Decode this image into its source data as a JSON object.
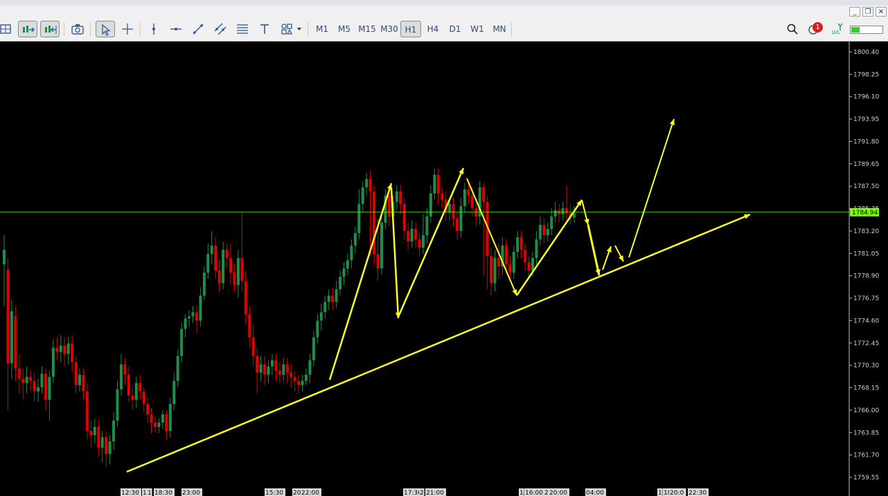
{
  "window_controls": {
    "minimize": "_",
    "restore": "❐",
    "close": "✕"
  },
  "toolbar": {
    "timeframes": [
      "M1",
      "M5",
      "M15",
      "M30",
      "H1",
      "H4",
      "D1",
      "W1",
      "MN"
    ],
    "active_timeframe": "H1",
    "notification_count": "1",
    "signal_label": "LVL"
  },
  "chart": {
    "background": "#000000",
    "bull_color": "#1e8f4a",
    "bear_color": "#e10000",
    "annotation_color": "#ffff20",
    "bid_line_color": "#7cfc00",
    "price_axis": {
      "ticks": [
        "1800.40",
        "1798.25",
        "1796.10",
        "1793.95",
        "1791.80",
        "1789.65",
        "1787.50",
        "1785.35",
        "1783.20",
        "1781.05",
        "1778.90",
        "1776.75",
        "1774.60",
        "1772.45",
        "1770.30",
        "1768.15",
        "1766.00",
        "1763.85",
        "1761.70",
        "1759.55"
      ]
    },
    "current_price": "1784.94",
    "time_labels": [
      "12:30",
      "1",
      "1",
      "18:30",
      "23:00",
      "15:30",
      "20:",
      "22:00",
      "17:30",
      "2",
      "21:00",
      "1",
      "16:00",
      "2",
      "20:00",
      "04:00",
      "1",
      "18:",
      "20:0",
      "22:30"
    ]
  },
  "chart_data": {
    "type": "candlestick",
    "y_axis": {
      "min": 1759.55,
      "max": 1800.4,
      "tick_labels": [
        "1800.40",
        "1798.25",
        "1796.10",
        "1793.95",
        "1791.80",
        "1789.65",
        "1787.50",
        "1785.35",
        "1783.20",
        "1781.05",
        "1778.90",
        "1776.75",
        "1774.60",
        "1772.45",
        "1770.30",
        "1768.15",
        "1766.00",
        "1763.85",
        "1761.70",
        "1759.55"
      ]
    },
    "current_price": 1784.94,
    "x_tick_labels": [
      "12:30",
      "1",
      "1",
      "18:30",
      "23:00",
      "15:30",
      "20:",
      "22:00",
      "17:30",
      "2",
      "21:00",
      "1",
      "16:00",
      "2",
      "20:00",
      "04:00",
      "1",
      "18:",
      "20:0",
      "22:30"
    ],
    "candles": [
      [
        1780.0,
        1781.4,
        1776.0,
        1782.8
      ],
      [
        1779.5,
        1770.5,
        1766.0,
        1780.6
      ],
      [
        1770.5,
        1775.5,
        1769.0,
        1776.6
      ],
      [
        1775.0,
        1770.0,
        1768.8,
        1776.0
      ],
      [
        1770.0,
        1769.0,
        1767.6,
        1771.4
      ],
      [
        1769.0,
        1768.6,
        1767.0,
        1770.0
      ],
      [
        1768.6,
        1769.2,
        1767.6,
        1770.2
      ],
      [
        1769.2,
        1768.8,
        1767.8,
        1769.8
      ],
      [
        1768.8,
        1767.8,
        1766.8,
        1769.6
      ],
      [
        1767.8,
        1768.2,
        1766.8,
        1769.0
      ],
      [
        1768.2,
        1769.5,
        1767.6,
        1770.2
      ],
      [
        1769.5,
        1767.0,
        1766.0,
        1770.0
      ],
      [
        1767.0,
        1769.2,
        1765.0,
        1769.8
      ],
      [
        1769.2,
        1772.0,
        1768.6,
        1772.8
      ],
      [
        1772.0,
        1771.6,
        1770.8,
        1773.0
      ],
      [
        1771.6,
        1772.2,
        1770.6,
        1773.2
      ],
      [
        1772.2,
        1771.4,
        1770.2,
        1773.0
      ],
      [
        1771.4,
        1772.4,
        1770.4,
        1773.0
      ],
      [
        1772.4,
        1770.6,
        1769.6,
        1773.2
      ],
      [
        1770.6,
        1768.4,
        1767.6,
        1771.2
      ],
      [
        1768.4,
        1769.4,
        1767.8,
        1770.0
      ],
      [
        1769.4,
        1767.8,
        1767.0,
        1770.0
      ],
      [
        1767.8,
        1764.0,
        1763.2,
        1768.6
      ],
      [
        1764.0,
        1763.6,
        1762.4,
        1765.0
      ],
      [
        1763.6,
        1764.4,
        1762.8,
        1765.2
      ],
      [
        1764.4,
        1762.4,
        1761.6,
        1765.0
      ],
      [
        1762.4,
        1763.4,
        1761.0,
        1764.0
      ],
      [
        1763.4,
        1761.8,
        1760.6,
        1764.0
      ],
      [
        1761.8,
        1763.0,
        1760.8,
        1763.6
      ],
      [
        1763.0,
        1765.0,
        1762.2,
        1765.8
      ],
      [
        1765.0,
        1768.0,
        1764.4,
        1768.8
      ],
      [
        1768.0,
        1770.4,
        1767.4,
        1771.4
      ],
      [
        1770.4,
        1769.4,
        1768.4,
        1771.0
      ],
      [
        1769.4,
        1767.4,
        1766.8,
        1770.2
      ],
      [
        1767.4,
        1767.0,
        1766.0,
        1768.2
      ],
      [
        1767.0,
        1768.6,
        1766.2,
        1769.2
      ],
      [
        1768.6,
        1767.8,
        1767.0,
        1769.4
      ],
      [
        1767.8,
        1766.6,
        1765.8,
        1768.2
      ],
      [
        1766.6,
        1765.6,
        1764.8,
        1767.2
      ],
      [
        1765.6,
        1764.8,
        1763.8,
        1766.2
      ],
      [
        1764.8,
        1764.4,
        1763.8,
        1765.4
      ],
      [
        1764.4,
        1764.8,
        1763.8,
        1765.2
      ],
      [
        1764.8,
        1765.6,
        1764.2,
        1766.0
      ],
      [
        1765.6,
        1764.0,
        1763.2,
        1766.0
      ],
      [
        1764.0,
        1766.6,
        1763.4,
        1767.2
      ],
      [
        1766.6,
        1768.8,
        1766.0,
        1769.6
      ],
      [
        1768.8,
        1771.2,
        1768.2,
        1771.8
      ],
      [
        1771.2,
        1773.8,
        1770.6,
        1774.4
      ],
      [
        1773.8,
        1774.8,
        1773.0,
        1775.2
      ],
      [
        1774.8,
        1775.0,
        1774.0,
        1775.6
      ],
      [
        1775.0,
        1775.4,
        1774.4,
        1776.0
      ],
      [
        1775.4,
        1774.6,
        1773.4,
        1776.0
      ],
      [
        1774.6,
        1777.0,
        1774.0,
        1777.8
      ],
      [
        1777.0,
        1779.2,
        1776.6,
        1779.8
      ],
      [
        1779.2,
        1781.0,
        1778.6,
        1782.0
      ],
      [
        1781.0,
        1781.8,
        1780.0,
        1783.2
      ],
      [
        1781.8,
        1779.4,
        1778.6,
        1782.6
      ],
      [
        1779.4,
        1778.2,
        1777.4,
        1780.4
      ],
      [
        1778.2,
        1781.4,
        1777.6,
        1782.2
      ],
      [
        1781.4,
        1780.6,
        1779.6,
        1782.0
      ],
      [
        1780.6,
        1779.2,
        1778.0,
        1782.0
      ],
      [
        1779.2,
        1778.0,
        1777.4,
        1780.0
      ],
      [
        1778.0,
        1780.6,
        1776.8,
        1781.4
      ],
      [
        1780.6,
        1778.4,
        1777.4,
        1785.0
      ],
      [
        1778.4,
        1775.2,
        1774.2,
        1779.4
      ],
      [
        1775.2,
        1773.0,
        1772.0,
        1776.0
      ],
      [
        1773.0,
        1771.2,
        1770.2,
        1774.2
      ],
      [
        1771.2,
        1769.6,
        1767.6,
        1772.0
      ],
      [
        1769.6,
        1770.4,
        1768.8,
        1771.2
      ],
      [
        1770.4,
        1769.4,
        1768.4,
        1771.2
      ],
      [
        1769.4,
        1770.2,
        1768.6,
        1770.8
      ],
      [
        1770.2,
        1770.8,
        1769.4,
        1771.4
      ],
      [
        1770.8,
        1769.8,
        1768.8,
        1771.4
      ],
      [
        1769.8,
        1769.4,
        1768.6,
        1770.6
      ],
      [
        1769.4,
        1770.4,
        1768.8,
        1771.0
      ],
      [
        1770.4,
        1769.6,
        1768.6,
        1771.0
      ],
      [
        1769.6,
        1769.2,
        1768.2,
        1770.4
      ],
      [
        1769.2,
        1768.8,
        1767.8,
        1769.8
      ],
      [
        1768.8,
        1768.4,
        1767.6,
        1769.4
      ],
      [
        1768.4,
        1768.8,
        1767.8,
        1769.4
      ],
      [
        1768.8,
        1769.4,
        1768.4,
        1770.0
      ],
      [
        1769.4,
        1770.8,
        1768.6,
        1771.4
      ],
      [
        1770.8,
        1773.0,
        1770.2,
        1773.6
      ],
      [
        1773.0,
        1774.6,
        1772.4,
        1775.2
      ],
      [
        1774.6,
        1775.4,
        1773.6,
        1776.2
      ],
      [
        1775.4,
        1776.4,
        1774.8,
        1777.0
      ],
      [
        1776.4,
        1777.0,
        1775.6,
        1777.6
      ],
      [
        1777.0,
        1776.4,
        1775.6,
        1777.8
      ],
      [
        1776.4,
        1777.6,
        1775.8,
        1778.4
      ],
      [
        1777.6,
        1778.8,
        1777.0,
        1779.4
      ],
      [
        1778.8,
        1779.6,
        1778.0,
        1780.2
      ],
      [
        1779.6,
        1780.4,
        1779.0,
        1781.0
      ],
      [
        1780.4,
        1781.8,
        1779.6,
        1782.4
      ],
      [
        1781.8,
        1783.0,
        1781.0,
        1783.6
      ],
      [
        1783.0,
        1785.8,
        1782.4,
        1787.2
      ],
      [
        1785.8,
        1787.4,
        1785.0,
        1788.0
      ],
      [
        1787.4,
        1788.2,
        1786.6,
        1788.8
      ],
      [
        1788.2,
        1787.0,
        1780.8,
        1789.0
      ],
      [
        1787.0,
        1781.0,
        1780.0,
        1787.6
      ],
      [
        1781.0,
        1779.6,
        1778.4,
        1784.4
      ],
      [
        1779.6,
        1784.0,
        1779.0,
        1784.8
      ],
      [
        1784.0,
        1786.6,
        1783.4,
        1787.2
      ],
      [
        1786.6,
        1784.6,
        1783.6,
        1787.4
      ],
      [
        1784.6,
        1786.0,
        1783.8,
        1786.6
      ],
      [
        1786.0,
        1787.0,
        1785.2,
        1787.6
      ],
      [
        1787.0,
        1785.8,
        1784.8,
        1787.6
      ],
      [
        1785.8,
        1783.2,
        1782.4,
        1786.4
      ],
      [
        1783.2,
        1782.2,
        1781.4,
        1784.0
      ],
      [
        1782.2,
        1783.4,
        1781.6,
        1784.2
      ],
      [
        1783.4,
        1782.4,
        1781.6,
        1784.0
      ],
      [
        1782.4,
        1781.6,
        1780.8,
        1783.0
      ],
      [
        1781.6,
        1782.8,
        1781.0,
        1784.8
      ],
      [
        1782.8,
        1784.6,
        1782.0,
        1785.4
      ],
      [
        1784.6,
        1786.8,
        1784.0,
        1787.6
      ],
      [
        1786.8,
        1788.6,
        1786.2,
        1789.2
      ],
      [
        1788.6,
        1786.8,
        1785.8,
        1789.2
      ],
      [
        1786.8,
        1786.2,
        1785.4,
        1787.4
      ],
      [
        1786.2,
        1785.0,
        1784.2,
        1787.0
      ],
      [
        1785.0,
        1785.8,
        1784.2,
        1786.4
      ],
      [
        1785.8,
        1784.4,
        1783.6,
        1786.4
      ],
      [
        1784.4,
        1783.2,
        1782.4,
        1785.0
      ],
      [
        1783.2,
        1785.6,
        1782.6,
        1786.4
      ],
      [
        1785.6,
        1787.2,
        1785.0,
        1787.8
      ],
      [
        1787.2,
        1786.6,
        1785.8,
        1787.8
      ],
      [
        1786.6,
        1785.4,
        1784.6,
        1787.4
      ],
      [
        1785.4,
        1784.6,
        1783.6,
        1786.0
      ],
      [
        1784.6,
        1787.4,
        1783.8,
        1788.0
      ],
      [
        1787.4,
        1786.0,
        1779.0,
        1787.8
      ],
      [
        1786.0,
        1780.8,
        1777.6,
        1786.6
      ],
      [
        1780.8,
        1778.2,
        1777.0,
        1781.6
      ],
      [
        1778.2,
        1780.6,
        1777.4,
        1781.4
      ],
      [
        1780.6,
        1779.8,
        1778.6,
        1782.0
      ],
      [
        1779.8,
        1781.8,
        1779.0,
        1782.6
      ],
      [
        1781.8,
        1780.0,
        1779.0,
        1782.4
      ],
      [
        1780.0,
        1779.2,
        1778.4,
        1780.8
      ],
      [
        1779.2,
        1781.2,
        1778.6,
        1781.8
      ],
      [
        1781.2,
        1782.6,
        1780.6,
        1783.2
      ],
      [
        1782.6,
        1781.4,
        1780.6,
        1783.2
      ],
      [
        1781.4,
        1780.2,
        1779.4,
        1782.0
      ],
      [
        1780.2,
        1779.4,
        1778.6,
        1780.8
      ],
      [
        1779.4,
        1780.6,
        1778.8,
        1781.2
      ],
      [
        1780.6,
        1782.4,
        1780.0,
        1783.2
      ],
      [
        1782.4,
        1783.8,
        1781.8,
        1784.6
      ],
      [
        1783.8,
        1782.8,
        1782.0,
        1784.4
      ],
      [
        1782.8,
        1783.4,
        1782.2,
        1784.0
      ],
      [
        1783.4,
        1784.6,
        1782.8,
        1785.4
      ],
      [
        1784.6,
        1785.2,
        1784.0,
        1786.0
      ],
      [
        1785.2,
        1784.8,
        1784.0,
        1785.8
      ],
      [
        1784.8,
        1785.4,
        1784.2,
        1786.0
      ],
      [
        1785.4,
        1784.9,
        1784.2,
        1787.6
      ],
      [
        1784.9,
        1784.5,
        1783.8,
        1785.8
      ],
      [
        1784.5,
        1784.9,
        1784.0,
        1785.6
      ]
    ],
    "annotations": {
      "trendline": [
        [
          0,
          1760.3
        ],
        [
          1,
          1784.7
        ]
      ],
      "zigzag_arrows": "yellow arrows marking swings and projected breakout"
    }
  }
}
